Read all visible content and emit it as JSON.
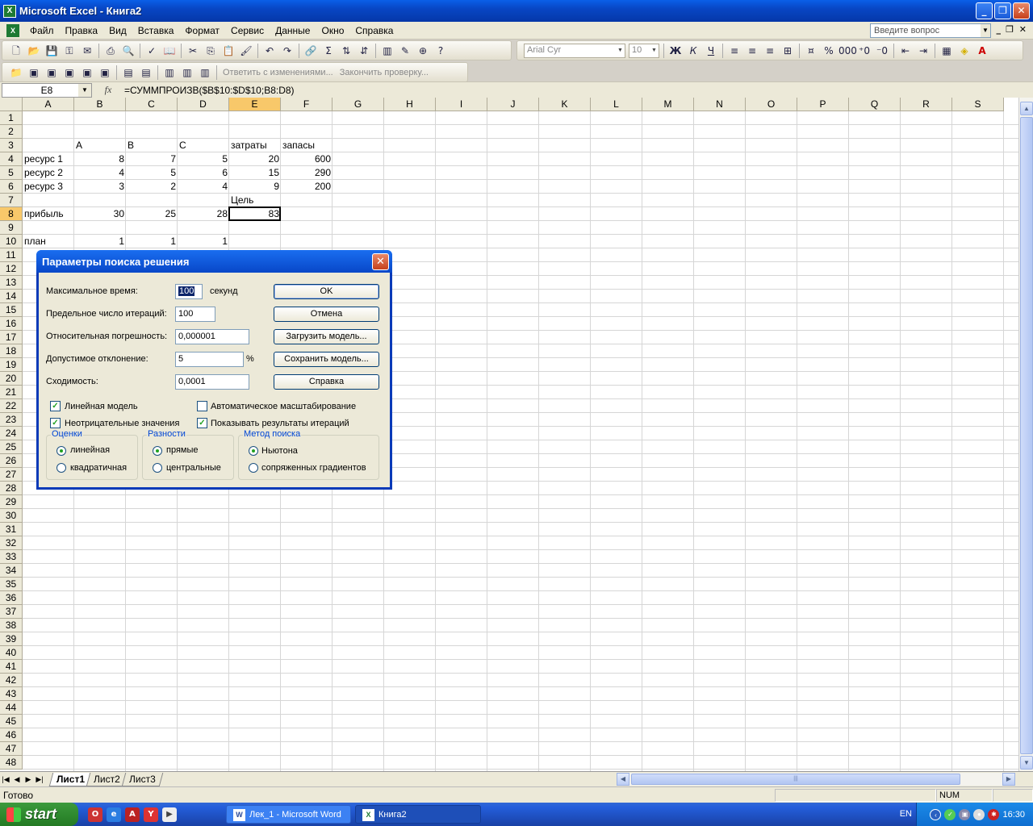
{
  "window": {
    "title": "Microsoft Excel - Книга2"
  },
  "menu": [
    "Файл",
    "Правка",
    "Вид",
    "Вставка",
    "Формат",
    "Сервис",
    "Данные",
    "Окно",
    "Справка"
  ],
  "ask_placeholder": "Введите вопрос",
  "toolbar": {
    "font": "Arial Cyr",
    "size": "10",
    "review_reply": "Ответить с изменениями...",
    "review_end": "Закончить проверку..."
  },
  "formula_bar": {
    "name_box": "E8",
    "fx": "fx",
    "formula": "=СУММПРОИЗВ($B$10:$D$10;B8:D8)"
  },
  "columns": [
    "A",
    "B",
    "C",
    "D",
    "E",
    "F",
    "G",
    "H",
    "I",
    "J",
    "K",
    "L",
    "M",
    "N",
    "O",
    "P",
    "Q",
    "R",
    "S"
  ],
  "rows": [
    "1",
    "2",
    "3",
    "4",
    "5",
    "6",
    "7",
    "8",
    "9",
    "10",
    "11",
    "12",
    "13",
    "14",
    "15",
    "16",
    "17",
    "18",
    "19",
    "20",
    "21",
    "22",
    "23",
    "24",
    "25",
    "26",
    "27",
    "28",
    "29",
    "30",
    "31",
    "32",
    "33",
    "34",
    "35",
    "36",
    "37",
    "38",
    "39",
    "40",
    "41",
    "42",
    "43",
    "44",
    "45",
    "46",
    "47",
    "48"
  ],
  "cells": {
    "B3": "A",
    "C3": "B",
    "D3": "C",
    "E3": "затраты",
    "F3": "запасы",
    "A4": "ресурс 1",
    "B4": "8",
    "C4": "7",
    "D4": "5",
    "E4": "20",
    "F4": "600",
    "A5": "ресурс 2",
    "B5": "4",
    "C5": "5",
    "D5": "6",
    "E5": "15",
    "F5": "290",
    "A6": "ресурс 3",
    "B6": "3",
    "C6": "2",
    "D6": "4",
    "E6": "9",
    "F6": "200",
    "E7": "Цель",
    "A8": "прибыль",
    "B8": "30",
    "C8": "25",
    "D8": "28",
    "E8": "83",
    "A10": "план",
    "B10": "1",
    "C10": "1",
    "D10": "1"
  },
  "sheets": [
    "Лист1",
    "Лист2",
    "Лист3"
  ],
  "status": {
    "text": "Готово",
    "num": "NUM"
  },
  "dialog": {
    "title": "Параметры поиска решения",
    "max_time_label": "Максимальное время:",
    "max_time": "100",
    "seconds": "секунд",
    "iterations_label": "Предельное число итераций:",
    "iterations": "100",
    "precision_label": "Относительная погрешность:",
    "precision": "0,000001",
    "tolerance_label": "Допустимое отклонение:",
    "tolerance": "5",
    "percent": "%",
    "convergence_label": "Сходимость:",
    "convergence": "0,0001",
    "buttons": {
      "ok": "OK",
      "cancel": "Отмена",
      "load": "Загрузить модель...",
      "save": "Сохранить модель...",
      "help": "Справка"
    },
    "linear_model": "Линейная модель",
    "linear_model_checked": true,
    "auto_scaling": "Автоматическое масштабирование",
    "auto_scaling_checked": false,
    "nonneg": "Неотрицательные значения",
    "nonneg_checked": true,
    "show_iter": "Показывать результаты итераций",
    "show_iter_checked": true,
    "estimates": {
      "title": "Оценки",
      "options": [
        "линейная",
        "квадратичная"
      ],
      "selected": 0
    },
    "derivatives": {
      "title": "Разности",
      "options": [
        "прямые",
        "центральные"
      ],
      "selected": 0
    },
    "search": {
      "title": "Метод поиска",
      "options": [
        "Ньютона",
        "сопряженных градиентов"
      ],
      "selected": 0
    }
  },
  "taskbar": {
    "start": "start",
    "tasks": [
      "Лек_1 - Microsoft Word",
      "Книга2"
    ],
    "lang": "EN",
    "clock": "16:30"
  }
}
